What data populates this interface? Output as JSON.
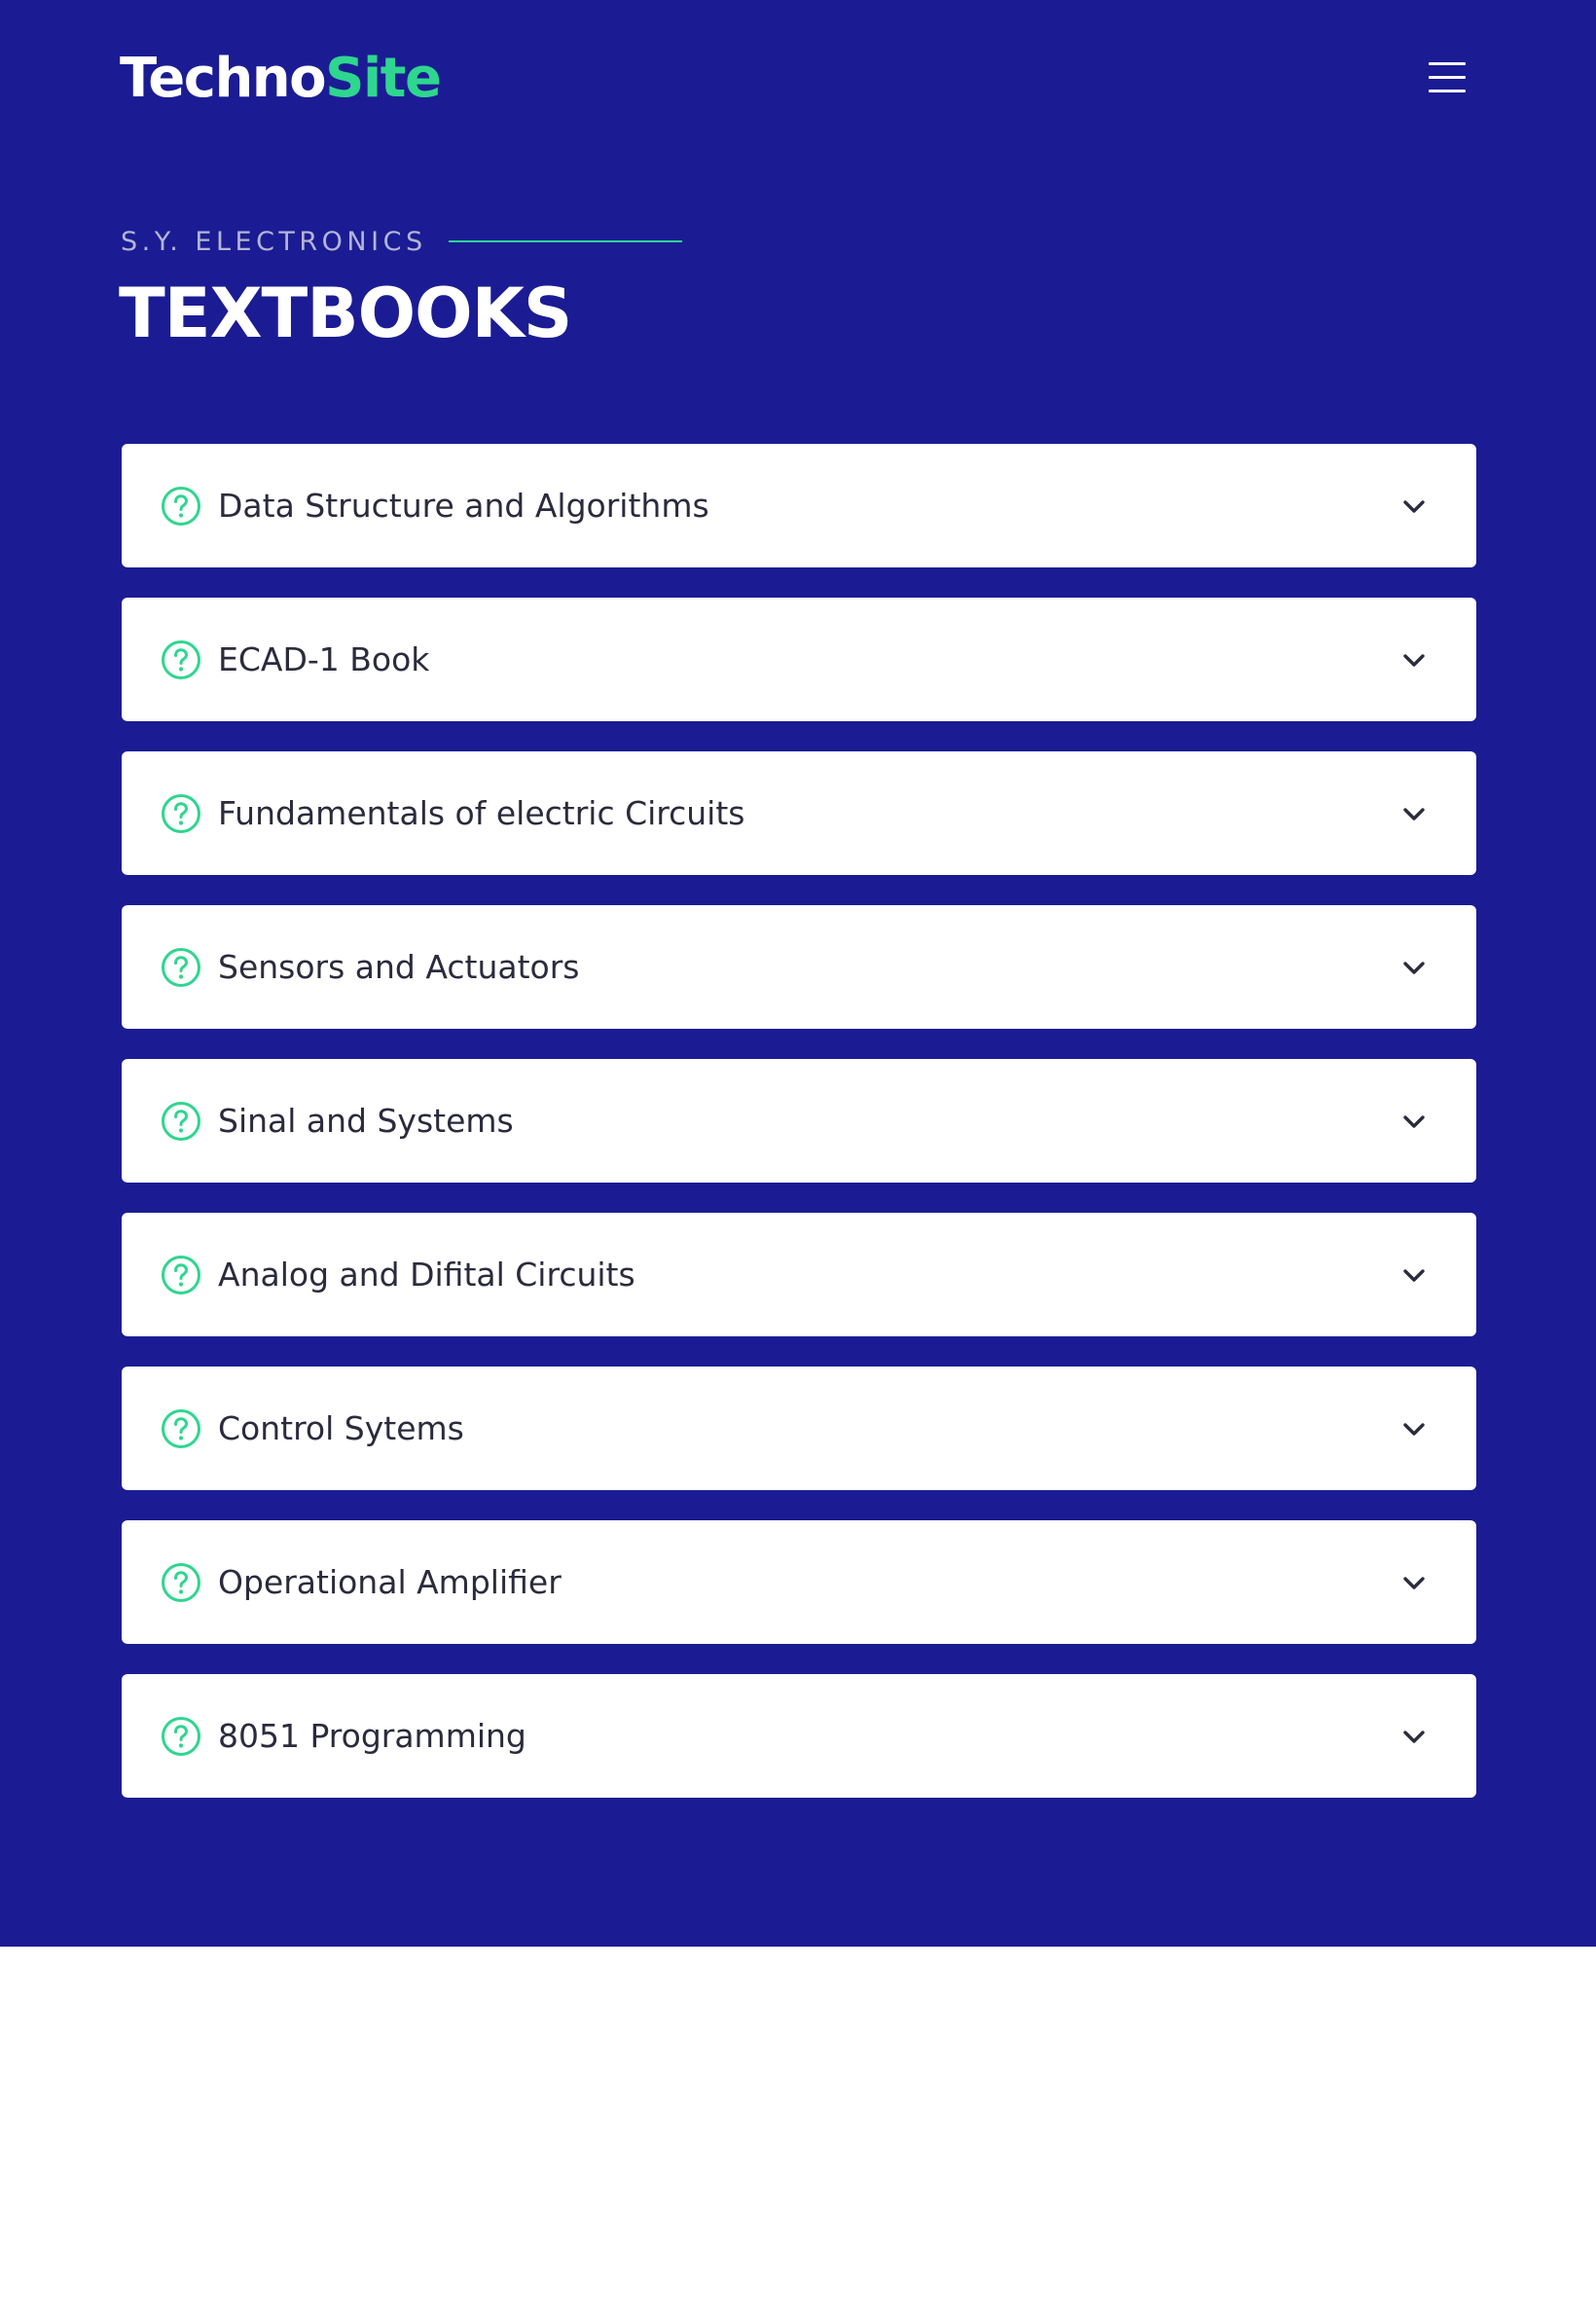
{
  "brand": {
    "logo_part1": "Techno",
    "logo_part2": "Site",
    "accent_color": "#2ed68f",
    "background_color": "#1b1c94"
  },
  "header": {
    "menu_icon": "hamburger-menu-icon"
  },
  "section": {
    "eyebrow": "S.Y. ELECTRONICS",
    "title": "TEXTBOOKS"
  },
  "accordion": {
    "item_icon": "question-circle-icon",
    "toggle_icon": "chevron-down-icon",
    "items": [
      {
        "label": "Data Structure and Algorithms"
      },
      {
        "label": "ECAD-1 Book"
      },
      {
        "label": "Fundamentals of electric Circuits"
      },
      {
        "label": "Sensors and Actuators"
      },
      {
        "label": "Sinal and Systems"
      },
      {
        "label": "Analog and Difital Circuits"
      },
      {
        "label": "Control Sytems"
      },
      {
        "label": "Operational Amplifier"
      },
      {
        "label": "8051 Programming"
      }
    ]
  }
}
